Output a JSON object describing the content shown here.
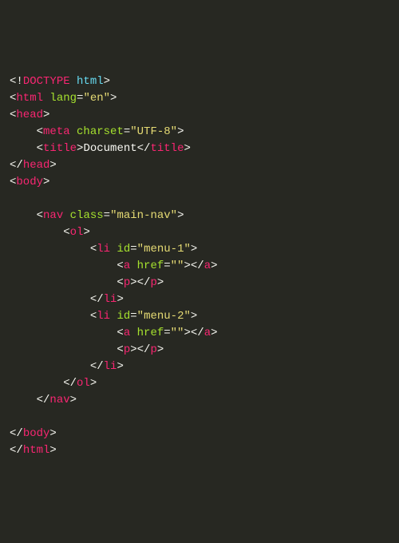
{
  "lines": [
    {
      "indent": 0,
      "kind": "doctype",
      "name": "DOCTYPE",
      "arg": "html"
    },
    {
      "indent": 0,
      "kind": "open",
      "name": "html",
      "attrs": [
        {
          "n": "lang",
          "v": "\"en\""
        }
      ]
    },
    {
      "indent": 0,
      "kind": "open",
      "name": "head"
    },
    {
      "indent": 1,
      "kind": "self",
      "name": "meta",
      "attrs": [
        {
          "n": "charset",
          "v": "\"UTF-8\""
        }
      ]
    },
    {
      "indent": 1,
      "kind": "wrap",
      "name": "title",
      "text": "Document"
    },
    {
      "indent": 0,
      "kind": "close",
      "name": "head"
    },
    {
      "indent": 0,
      "kind": "open",
      "name": "body"
    },
    {
      "indent": 0,
      "kind": "blank"
    },
    {
      "indent": 1,
      "kind": "open",
      "name": "nav",
      "attrs": [
        {
          "n": "class",
          "v": "\"main-nav\""
        }
      ]
    },
    {
      "indent": 2,
      "kind": "open",
      "name": "ol"
    },
    {
      "indent": 3,
      "kind": "open",
      "name": "li",
      "attrs": [
        {
          "n": "id",
          "v": "\"menu-1\""
        }
      ]
    },
    {
      "indent": 4,
      "kind": "wrap",
      "name": "a",
      "attrs": [
        {
          "n": "href",
          "v": "\"\""
        }
      ],
      "text": ""
    },
    {
      "indent": 4,
      "kind": "wrap",
      "name": "p",
      "text": ""
    },
    {
      "indent": 3,
      "kind": "close",
      "name": "li"
    },
    {
      "indent": 3,
      "kind": "open",
      "name": "li",
      "attrs": [
        {
          "n": "id",
          "v": "\"menu-2\""
        }
      ]
    },
    {
      "indent": 4,
      "kind": "wrap",
      "name": "a",
      "attrs": [
        {
          "n": "href",
          "v": "\"\""
        }
      ],
      "text": ""
    },
    {
      "indent": 4,
      "kind": "wrap",
      "name": "p",
      "text": ""
    },
    {
      "indent": 3,
      "kind": "close",
      "name": "li"
    },
    {
      "indent": 2,
      "kind": "close",
      "name": "ol"
    },
    {
      "indent": 1,
      "kind": "close",
      "name": "nav"
    },
    {
      "indent": 0,
      "kind": "blank"
    },
    {
      "indent": 0,
      "kind": "close",
      "name": "body"
    },
    {
      "indent": 0,
      "kind": "close",
      "name": "html"
    }
  ],
  "indent_unit": "    "
}
